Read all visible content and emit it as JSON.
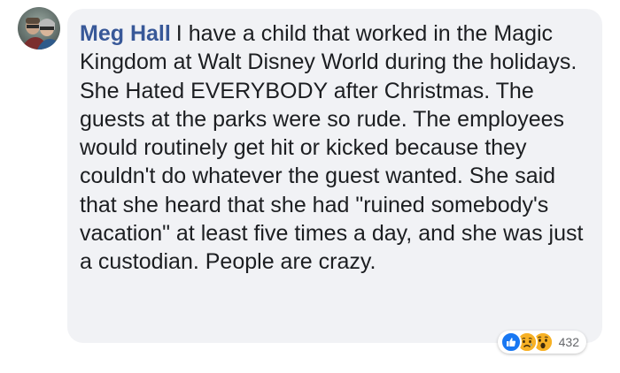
{
  "comment": {
    "author": "Meg Hall",
    "text": "I have a child that worked in the Magic Kingdom at Walt Disney World during the holidays. She Hated EVERYBODY after Christmas. The guests at the parks were so rude. The employees would routinely get hit or kicked because they couldn't do whatever the guest wanted. She said that she heard that she had \"ruined somebody's vacation\" at least five times a day, and she was just a custodian. People are crazy."
  },
  "reactions": {
    "icons": [
      "like-icon",
      "sad-icon",
      "wow-icon"
    ],
    "count": "432"
  },
  "colors": {
    "bubble_bg": "#f1f2f5",
    "author": "#385898",
    "text": "#1c1e21",
    "like": "#1877f2",
    "emoji": "#f7b125"
  }
}
